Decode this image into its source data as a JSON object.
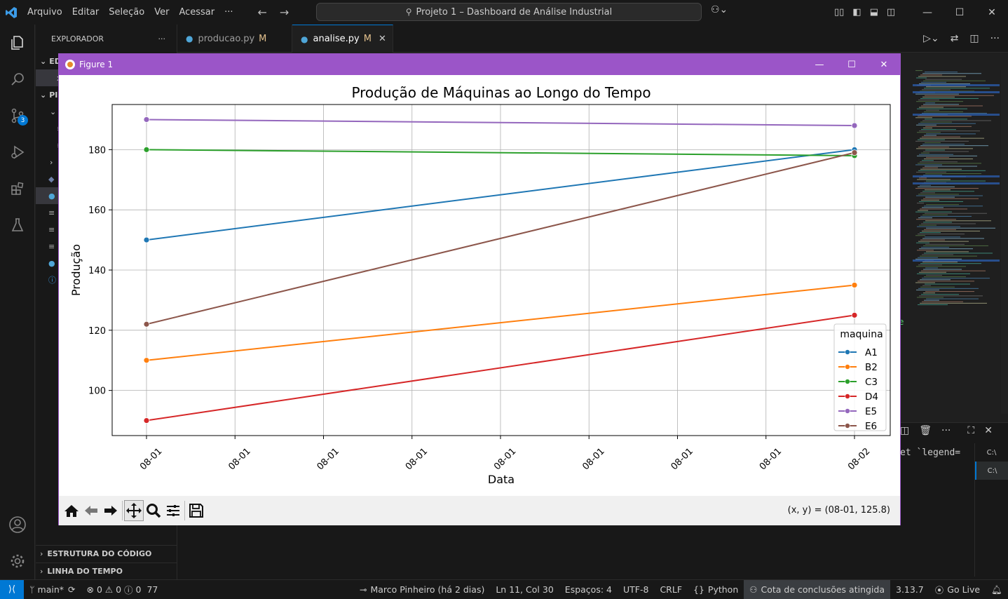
{
  "app": {
    "menu": [
      "Arquivo",
      "Editar",
      "Seleção",
      "Ver",
      "Acessar",
      "···"
    ],
    "command_center": "Projeto 1 – Dashboard de Análise Industrial",
    "brand_color": "#0078d4"
  },
  "activity_bar": {
    "scm_badge": "3"
  },
  "sidebar": {
    "header": "EXPLORADOR",
    "more": "···",
    "sections": {
      "outline": "ESTRUTURA DO CÓDIGO",
      "timeline": "LINHA DO TEMPO"
    },
    "partial_labels": [
      "ED",
      "PI"
    ]
  },
  "tabs": [
    {
      "label": "producao.py",
      "mod": "M",
      "active": false
    },
    {
      "label": "analise.py",
      "mod": "M",
      "active": true
    }
  ],
  "terminal": {
    "visible_text": "et `legend="
  },
  "figure": {
    "window_title": "Figure 1",
    "coord_readout": "(x, y) = (08-01, 125.8)"
  },
  "chart_data": {
    "type": "line",
    "title": "Produção de Máquinas ao Longo do Tempo",
    "xlabel": "Data",
    "ylabel": "Produção",
    "x_tick_labels": [
      "08-01",
      "08-01",
      "08-01",
      "08-01",
      "08-01",
      "08-01",
      "08-01",
      "08-01",
      "08-02"
    ],
    "x": [
      "08-01",
      "08-02"
    ],
    "ylim": [
      85,
      195
    ],
    "y_ticks": [
      100,
      120,
      140,
      160,
      180
    ],
    "grid": true,
    "legend_title": "maquina",
    "legend_position": "lower-right",
    "series": [
      {
        "name": "A1",
        "values": [
          150,
          180
        ],
        "color": "#1f77b4"
      },
      {
        "name": "B2",
        "values": [
          110,
          135
        ],
        "color": "#ff7f0e"
      },
      {
        "name": "C3",
        "values": [
          180,
          178
        ],
        "color": "#2ca02c"
      },
      {
        "name": "D4",
        "values": [
          90,
          125
        ],
        "color": "#d62728"
      },
      {
        "name": "E5",
        "values": [
          190,
          188
        ],
        "color": "#9467bd"
      },
      {
        "name": "E6",
        "values": [
          122,
          179
        ],
        "color": "#8c564b"
      }
    ]
  },
  "status_bar": {
    "branch": "main*",
    "errors": "0",
    "warnings": "0",
    "info": "0",
    "info_count": "77",
    "blame": "Marco Pinheiro (há 2 dias)",
    "position": "Ln 11, Col 30",
    "spaces": "Espaços: 4",
    "encoding": "UTF-8",
    "eol": "CRLF",
    "language": "Python",
    "quota": "Cota de conclusões atingida",
    "version": "3.13.7",
    "golive": "Go Live"
  }
}
